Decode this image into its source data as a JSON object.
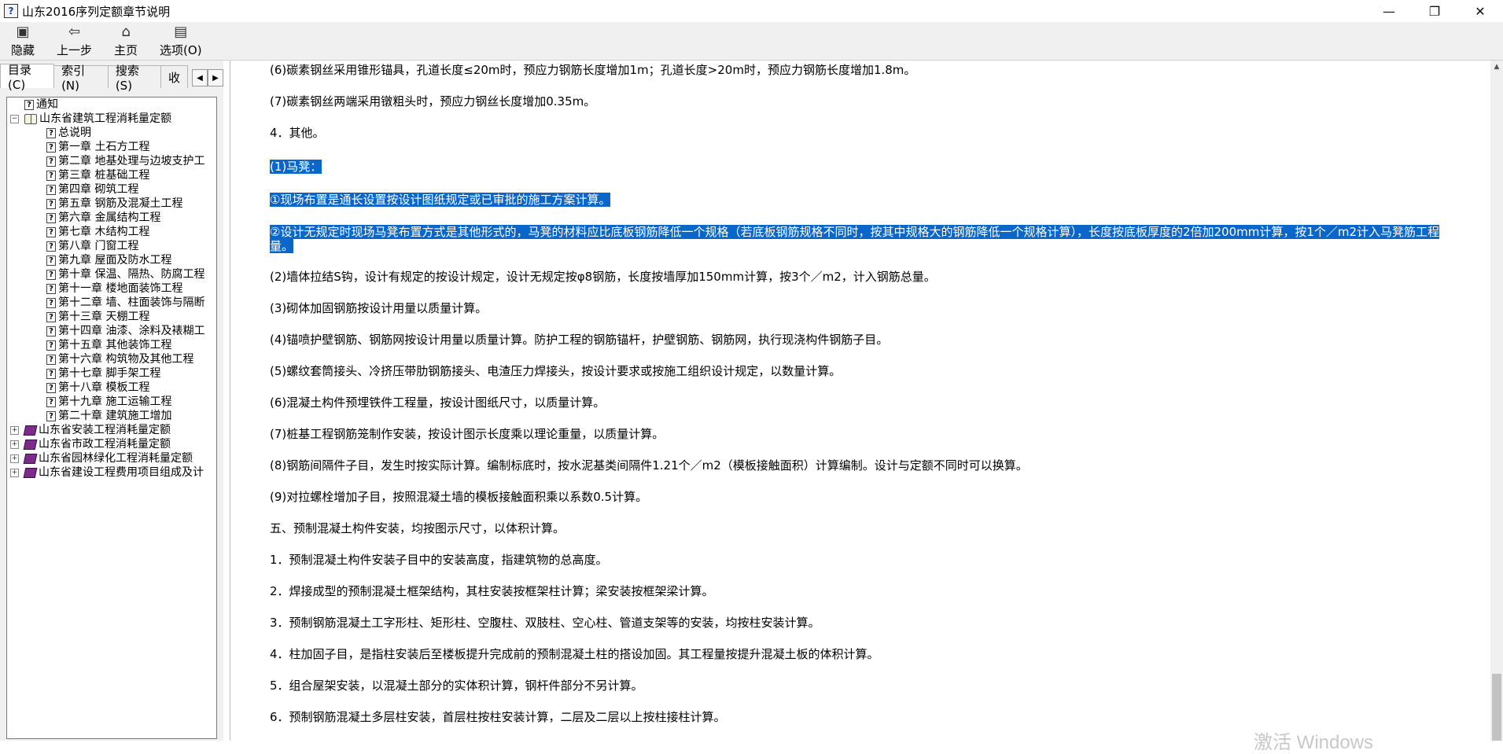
{
  "window": {
    "title": "山东2016序列定额章节说明",
    "app_icon": "help-file-icon",
    "controls": {
      "minimize": "—",
      "maximize": "❐",
      "close": "✕"
    }
  },
  "toolbar": {
    "buttons": [
      {
        "label": "隐藏",
        "icon": "hide-pane-icon",
        "glyph": "▣"
      },
      {
        "label": "上一步",
        "icon": "back-arrow-icon",
        "glyph": "⇦"
      },
      {
        "label": "主页",
        "icon": "home-icon",
        "glyph": "⌂"
      },
      {
        "label": "选项(O)",
        "icon": "options-icon",
        "glyph": "▤"
      }
    ]
  },
  "nav_tabs": [
    {
      "label": "目录(C)"
    },
    {
      "label": "索引(N)"
    },
    {
      "label": "搜索(S)"
    },
    {
      "label": "收"
    }
  ],
  "tree": {
    "items": [
      {
        "label": "通知",
        "icon": "help-page-icon"
      },
      {
        "label": "山东省建筑工程消耗量定额",
        "icon": "book-open-icon",
        "expander": "⊟"
      },
      {
        "label": "总说明",
        "icon": "help-page-icon"
      },
      {
        "label": "第一章 土石方工程",
        "icon": "help-page-icon"
      },
      {
        "label": "第二章 地基处理与边坡支护工",
        "icon": "help-page-icon"
      },
      {
        "label": "第三章 桩基础工程",
        "icon": "help-page-icon"
      },
      {
        "label": "第四章 砌筑工程",
        "icon": "help-page-icon"
      },
      {
        "label": "第五章 钢筋及混凝土工程",
        "icon": "help-page-icon"
      },
      {
        "label": "第六章 金属结构工程",
        "icon": "help-page-icon"
      },
      {
        "label": "第七章 木结构工程",
        "icon": "help-page-icon"
      },
      {
        "label": "第八章 门窗工程",
        "icon": "help-page-icon"
      },
      {
        "label": "第九章 屋面及防水工程",
        "icon": "help-page-icon"
      },
      {
        "label": "第十章 保温、隔热、防腐工程",
        "icon": "help-page-icon"
      },
      {
        "label": "第十一章 楼地面装饰工程",
        "icon": "help-page-icon"
      },
      {
        "label": "第十二章 墙、柱面装饰与隔断",
        "icon": "help-page-icon"
      },
      {
        "label": "第十三章 天棚工程",
        "icon": "help-page-icon"
      },
      {
        "label": "第十四章 油漆、涂料及裱糊工",
        "icon": "help-page-icon"
      },
      {
        "label": "第十五章 其他装饰工程",
        "icon": "help-page-icon"
      },
      {
        "label": "第十六章 构筑物及其他工程",
        "icon": "help-page-icon"
      },
      {
        "label": "第十七章 脚手架工程",
        "icon": "help-page-icon"
      },
      {
        "label": "第十八章 模板工程",
        "icon": "help-page-icon"
      },
      {
        "label": "第十九章 施工运输工程",
        "icon": "help-page-icon"
      },
      {
        "label": "第二十章 建筑施工增加",
        "icon": "help-page-icon"
      },
      {
        "label": "山东省安装工程消耗量定额",
        "icon": "book-closed-icon",
        "expander": "⊞"
      },
      {
        "label": "山东省市政工程消耗量定额",
        "icon": "book-closed-icon",
        "expander": "⊞"
      },
      {
        "label": "山东省园林绿化工程消耗量定额",
        "icon": "book-closed-icon",
        "expander": "⊞"
      },
      {
        "label": "山东省建设工程费用项目组成及计",
        "icon": "book-closed-icon",
        "expander": "⊞"
      }
    ]
  },
  "content": {
    "paragraphs": [
      {
        "text": "(6)碳素钢丝采用锥形锚具，孔道长度≤20m时，预应力钢筋长度增加1m；孔道长度>20m时，预应力钢筋长度增加1.8m。"
      },
      {
        "text": "(7)碳素钢丝两端采用镦粗头时，预应力钢丝长度增加0.35m。"
      },
      {
        "text": "4．其他。"
      },
      {
        "text": "(1)马凳：",
        "selected": true
      },
      {
        "text": "①现场布置是通长设置按设计图纸规定或已审批的施工方案计算。",
        "selected": true
      },
      {
        "text": "②设计无规定时现场马凳布置方式是其他形式的，马凳的材料应比底板钢筋降低一个规格（若底板钢筋规格不同时，按其中规格大的钢筋降低一个规格计算），长度按底板厚度的2倍加200mm计算，按1个／m2计入马凳筋工程量。",
        "selected": true
      },
      {
        "text": "(2)墙体拉结S钩，设计有规定的按设计规定，设计无规定按φ8钢筋，长度按墙厚加150mm计算，按3个／m2，计入钢筋总量。"
      },
      {
        "text": "(3)砌体加固钢筋按设计用量以质量计算。"
      },
      {
        "text": "(4)锚喷护壁钢筋、钢筋网按设计用量以质量计算。防护工程的钢筋锚杆，护壁钢筋、钢筋网，执行现浇构件钢筋子目。"
      },
      {
        "text": "(5)螺纹套筒接头、冷挤压带肋钢筋接头、电渣压力焊接头，按设计要求或按施工组织设计规定，以数量计算。"
      },
      {
        "text": "(6)混凝土构件预埋铁件工程量，按设计图纸尺寸，以质量计算。"
      },
      {
        "text": "(7)桩基工程钢筋笼制作安装，按设计图示长度乘以理论重量，以质量计算。"
      },
      {
        "text": "(8)钢筋间隔件子目，发生时按实际计算。编制标底时，按水泥基类间隔件1.21个／m2（模板接触面积）计算编制。设计与定额不同时可以换算。"
      },
      {
        "text": "(9)对拉螺栓增加子目，按照混凝土墙的模板接触面积乘以系数0.5计算。"
      },
      {
        "text": "五、预制混凝土构件安装，均按图示尺寸，以体积计算。"
      },
      {
        "text": "1．预制混凝土构件安装子目中的安装高度，指建筑物的总高度。"
      },
      {
        "text": "2．焊接成型的预制混凝土框架结构，其柱安装按框架柱计算；梁安装按框架梁计算。"
      },
      {
        "text": "3．预制钢筋混凝土工字形柱、矩形柱、空腹柱、双肢柱、空心柱、管道支架等的安装，均按柱安装计算。"
      },
      {
        "text": "4．柱加固子目，是指柱安装后至楼板提升完成前的预制混凝土柱的搭设加固。其工程量按提升混凝土板的体积计算。"
      },
      {
        "text": "5．组合屋架安装，以混凝土部分的实体积计算，钢杆件部分不另计算。"
      },
      {
        "text": "6．预制钢筋混凝土多层柱安装，首层柱按柱安装计算，二层及二层以上按柱接柱计算。"
      }
    ]
  },
  "watermark": {
    "text": "激活 Windows"
  },
  "colors": {
    "selection": "#0a66c8",
    "toolbar_bg": "#f0f0f0",
    "closed_book": "#7b2c8a"
  }
}
